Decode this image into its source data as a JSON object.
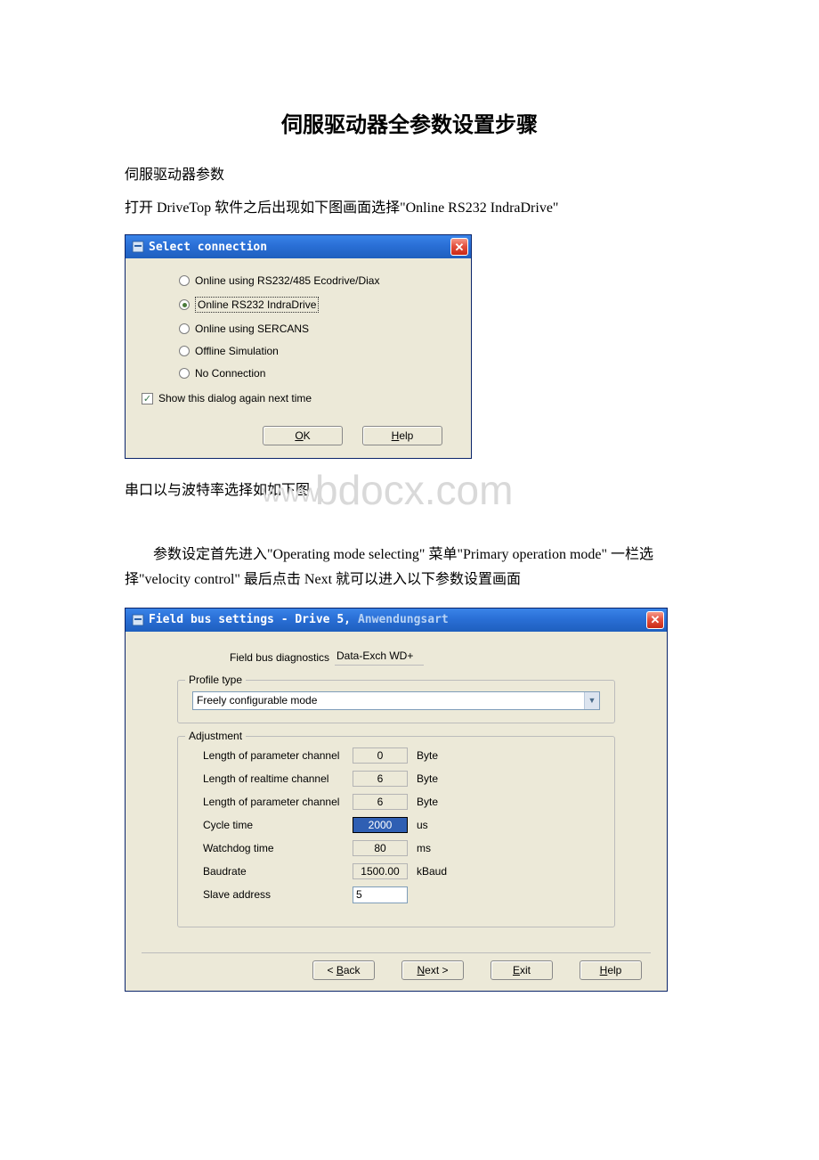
{
  "title": "伺服驱动器全参数设置步骤",
  "para1": "伺服驱动器参数",
  "para2": "打开 DriveTop 软件之后出现如下图画面选择\"Online RS232 IndraDrive\"",
  "caption1": "串口以与波特率选择如如下图",
  "watermark1": "bdocx.com",
  "watermark0": "www.",
  "para3": "参数设定首先进入\"Operating mode selecting\" 菜单\"Primary operation mode\" 一栏选择\"velocity control\" 最后点击 Next 就可以进入以下参数设置画面",
  "dialog1": {
    "title": "Select connection",
    "options": [
      "Online using RS232/485 Ecodrive/Diax",
      "Online RS232 IndraDrive",
      "Online using SERCANS",
      "Offline Simulation",
      "No Connection"
    ],
    "selectedIndex": 1,
    "checkbox_label": "Show this dialog again next time",
    "ok": "OK",
    "help": "Help"
  },
  "dialog2": {
    "title1": "Field bus settings - Drive 5,",
    "title2": "Anwendungsart",
    "diag_label": "Field bus diagnostics",
    "diag_value": "Data-Exch WD+",
    "profile_legend": "Profile type",
    "profile_value": "Freely configurable mode",
    "adjust_legend": "Adjustment",
    "rows": [
      {
        "label": "Length of parameter channel",
        "value": "0",
        "unit": "Byte",
        "type": "ro"
      },
      {
        "label": "Length of realtime channel",
        "value": "6",
        "unit": "Byte",
        "type": "ro"
      },
      {
        "label": "Length of parameter channel",
        "value": "6",
        "unit": "Byte",
        "type": "ro"
      },
      {
        "label": "Cycle time",
        "value": "2000",
        "unit": "us",
        "type": "hi"
      },
      {
        "label": "Watchdog time",
        "value": "80",
        "unit": "ms",
        "type": "ro"
      },
      {
        "label": "Baudrate",
        "value": "1500.00",
        "unit": "kBaud",
        "type": "ro"
      },
      {
        "label": "Slave address",
        "value": "5",
        "unit": "",
        "type": "in"
      }
    ],
    "back": "Back",
    "next": "Next >",
    "exit": "Exit",
    "help": "Help"
  }
}
